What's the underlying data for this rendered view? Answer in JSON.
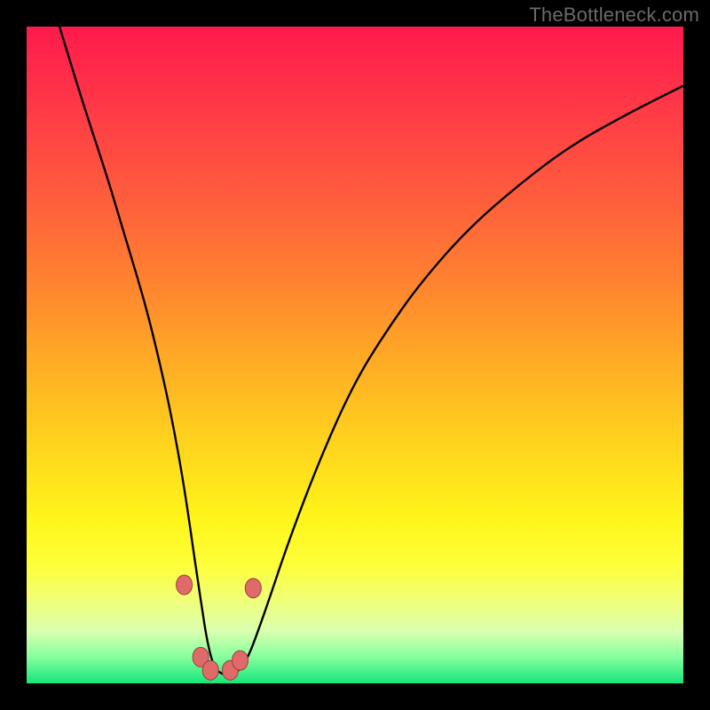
{
  "watermark": "TheBottleneck.com",
  "colors": {
    "background": "#000000",
    "gradient_top": "#ff1a4d",
    "gradient_bottom": "#15e67a",
    "curve": "#000000",
    "marker_fill": "#e06a6a",
    "marker_stroke": "#9d3d3d"
  },
  "chart_data": {
    "type": "line",
    "title": "",
    "xlabel": "",
    "ylabel": "",
    "xlim": [
      0,
      100
    ],
    "ylim": [
      0,
      100
    ],
    "grid": false,
    "legend": false,
    "series": [
      {
        "name": "bottleneck-curve",
        "x": [
          5,
          9,
          12,
          15,
          18,
          20,
          22,
          24,
          26,
          28,
          30,
          33,
          36,
          40,
          45,
          50,
          55,
          60,
          67,
          75,
          83,
          92,
          100
        ],
        "values": [
          100,
          87,
          78,
          68,
          58,
          50,
          41,
          30,
          16,
          3,
          1,
          2,
          10,
          22,
          35,
          46,
          54,
          61,
          69,
          76,
          82,
          87,
          91
        ]
      }
    ],
    "markers": [
      {
        "x": 24.0,
        "y": 15.0
      },
      {
        "x": 26.5,
        "y": 4.0
      },
      {
        "x": 28.0,
        "y": 2.0
      },
      {
        "x": 31.0,
        "y": 2.0
      },
      {
        "x": 32.5,
        "y": 3.5
      },
      {
        "x": 34.5,
        "y": 14.5
      }
    ]
  }
}
